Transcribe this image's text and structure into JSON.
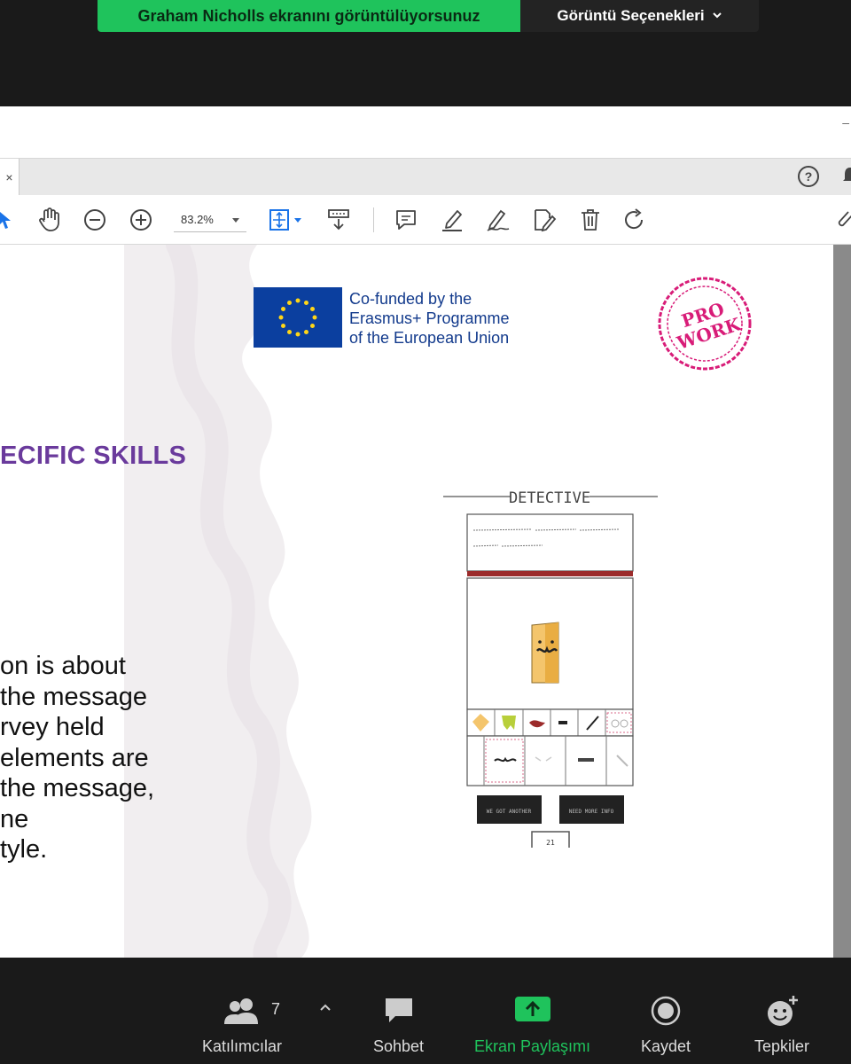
{
  "banner": {
    "sharing_text": "Graham Nicholls ekranını görüntülüyorsunuz",
    "options_label": "Görüntü Seçenekleri",
    "accent": "#1fc35c"
  },
  "viewer": {
    "tab_close": "×",
    "help_label": "?",
    "zoom_value": "83.2%",
    "toolbar_icons": [
      "arrow-icon",
      "hand-icon",
      "zoom-out-icon",
      "zoom-in-icon",
      "page-fit-icon",
      "scroll-mode-icon",
      "comment-icon",
      "highlight-icon",
      "sign-icon",
      "fill-sign-icon",
      "delete-icon",
      "rotate-icon",
      "attach-icon"
    ]
  },
  "slide": {
    "eu_lines": [
      "Co-funded by the",
      "Erasmus+ Programme",
      "of the European Union"
    ],
    "stamp_top": "PRO",
    "stamp_bottom": "WORK",
    "heading": "ECIFIC SKILLS",
    "body_lines": [
      "on is about",
      "the message",
      "rvey held",
      "elements are",
      "the message,",
      "ne",
      "tyle."
    ],
    "game": {
      "title": "DETECTIVE",
      "button_left": "WE GOT ANOTHER",
      "button_right": "NEED MORE INFO",
      "counter": "21"
    },
    "heading_color": "#6a3a9c"
  },
  "zoom_bar": {
    "participants_label": "Katılımcılar",
    "participants_count": "7",
    "chat_label": "Sohbet",
    "share_label": "Ekran Paylaşımı",
    "record_label": "Kaydet",
    "reactions_label": "Tepkiler"
  }
}
